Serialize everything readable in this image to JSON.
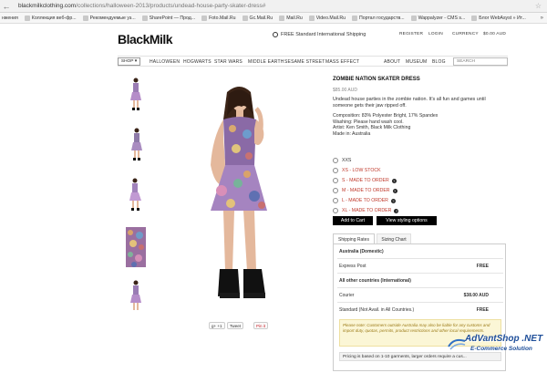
{
  "browser": {
    "url_main": "blackmilkclothing.com",
    "url_rest": "/collections/halloween-2013/products/undead-house-party-skater-dress#",
    "bookmarks": [
      "Коллекция веб-фр...",
      "Рекомендуемые уз...",
      "SharePoint — Прод...",
      "Foto.Mail.Ru",
      "Gc.Mail.Ru",
      "Mail.Ru",
      "Video.Mail.Ru",
      "Портал государств...",
      "Wappalyzer - CMS s...",
      "Блог WebAsyst » Ит..."
    ],
    "bookmarks_prefix": "нжения",
    "more": "»"
  },
  "header": {
    "logo": "BlackMilk",
    "shipping": "FREE Standard International Shipping",
    "register": "REGISTER",
    "login": "LOGIN",
    "currency": "CURRENCY",
    "cart": "$0.00 AUD"
  },
  "nav": {
    "shop": "SHOP ▾",
    "items": [
      "HALLOWEEN",
      "HOGWARTS",
      "STAR WARS",
      "MIDDLE EARTH",
      "SESAME STREET",
      "MASS EFFECT"
    ],
    "right": [
      "ABOUT",
      "MUSEUM",
      "BLOG"
    ],
    "search_placeholder": "SEARCH"
  },
  "product": {
    "title": "ZOMBIE NATION SKATER DRESS",
    "price": "$85.00 AUD",
    "description": "Undead house parties in the zombie nation. It's all fun and games until someone gets their jaw ripped off.",
    "composition": "Composition: 83% Polyester Bright, 17% Spandex",
    "washing": "Washing: Please hand wash cool.",
    "artist": "Artist: Ken Smith, Black Milk Clothing",
    "made": "Made in: Australia",
    "sizes": [
      {
        "label": "XXS",
        "note": ""
      },
      {
        "label": "XS - LOW STOCK",
        "note": ""
      },
      {
        "label": "S - MADE TO ORDER",
        "note": "?"
      },
      {
        "label": "M - MADE TO ORDER",
        "note": "?"
      },
      {
        "label": "L - MADE TO ORDER",
        "note": "?"
      },
      {
        "label": "XL - MADE TO ORDER",
        "note": "?"
      }
    ],
    "add_to_cart": "Add to Cart",
    "styling": "View styling options"
  },
  "share": {
    "gplus": "g+ +1",
    "tweet": "Tweet",
    "pin": "Pin it"
  },
  "shipping_tabs": {
    "tab1": "Shipping Rates",
    "tab2": "Sizing Chart",
    "domestic_title": "Australia (Domestic)",
    "express": "Express Post",
    "express_price": "FREE",
    "intl_title": "All other countries (International)",
    "courier": "Courier",
    "courier_price": "$38.00 AUD",
    "standard": "Standard (Not Avail. in All Countries.)",
    "standard_price": "FREE",
    "note": "Please note: Customers outside Australia may also be liable for any customs and import duty, quotas, permits, product restrictions and other local requirements.",
    "pricing": "Pricing is based on 1-10 garments, larger orders require a cus..."
  },
  "watermark": {
    "line1": "AdVantShop .NET",
    "line2": "E-Commerce Solution"
  }
}
